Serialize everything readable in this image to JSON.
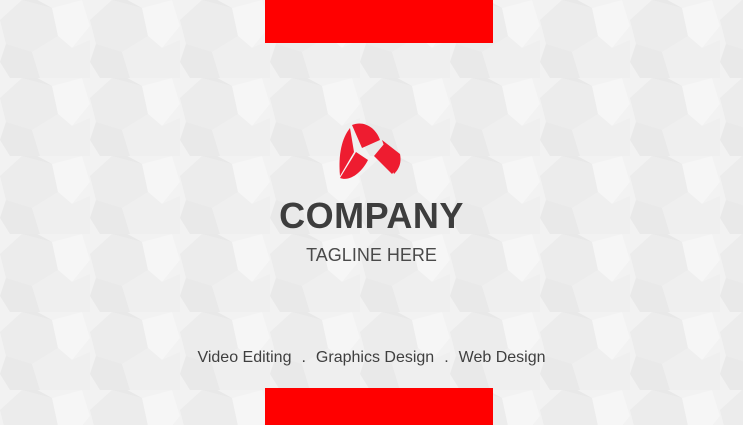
{
  "brand": {
    "company": "COMPANY",
    "tagline": "TAGLINE HERE",
    "accent_color": "#ff0000",
    "logo_color": "#ee1c30",
    "logo_icon": "tri-swirl-logo-icon"
  },
  "services": {
    "items": [
      "Video Editing",
      "Graphics Design",
      "Web Design"
    ],
    "separator": "."
  }
}
